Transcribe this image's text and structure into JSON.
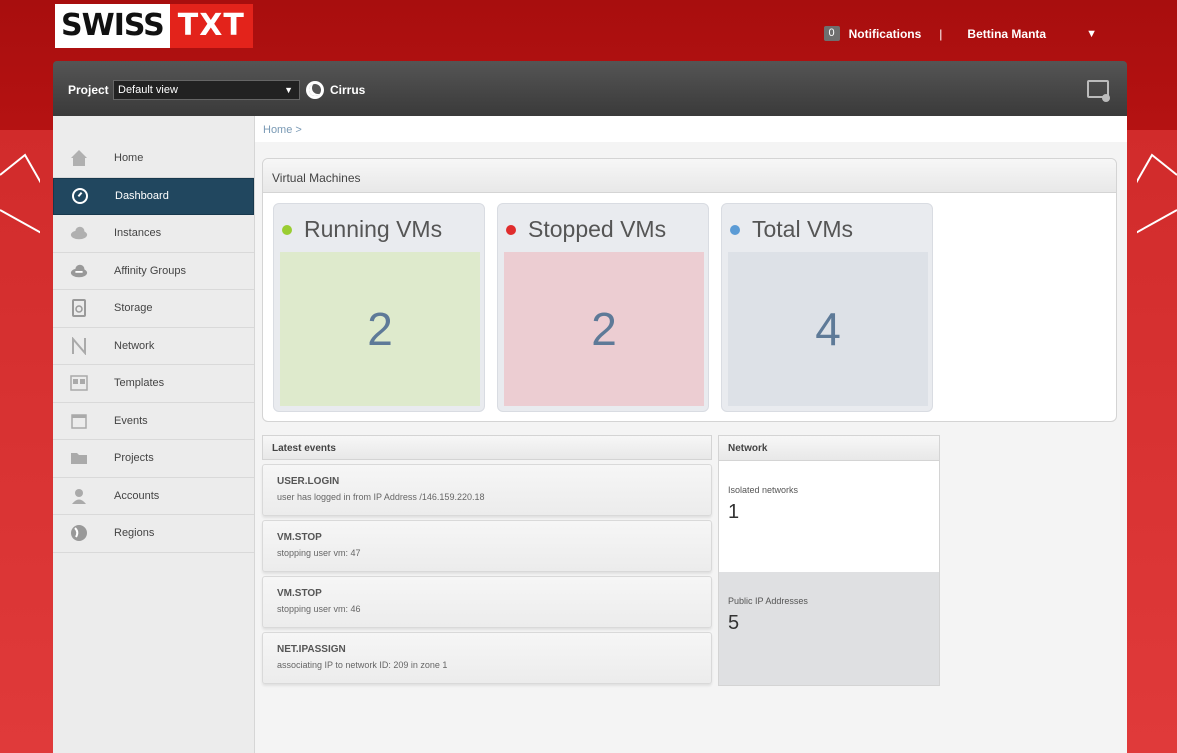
{
  "header": {
    "logo_part1": "SWISS",
    "logo_part2": "TXT",
    "notifications_count": "0",
    "notifications_label": "Notifications",
    "separator": "|",
    "user_name": "Bettina Manta",
    "user_caret": "▼"
  },
  "project_bar": {
    "project_label": "Project",
    "project_select_value": "Default view",
    "zone_name": "Cirrus"
  },
  "sidebar": {
    "items": [
      {
        "label": "Home",
        "icon": "home-icon"
      },
      {
        "label": "Dashboard",
        "icon": "dashboard-icon",
        "active": true
      },
      {
        "label": "Instances",
        "icon": "cloud-icon"
      },
      {
        "label": "Affinity Groups",
        "icon": "affinity-cloud-icon"
      },
      {
        "label": "Storage",
        "icon": "disk-icon"
      },
      {
        "label": "Network",
        "icon": "network-icon"
      },
      {
        "label": "Templates",
        "icon": "templates-icon"
      },
      {
        "label": "Events",
        "icon": "calendar-icon"
      },
      {
        "label": "Projects",
        "icon": "folder-icon"
      },
      {
        "label": "Accounts",
        "icon": "user-icon"
      },
      {
        "label": "Regions",
        "icon": "globe-icon"
      }
    ]
  },
  "breadcrumb": {
    "home": "Home",
    "sep": ">"
  },
  "vm_panel": {
    "title": "Virtual Machines",
    "cards": [
      {
        "label": "Running VMs",
        "value": "2",
        "dot_color": "#9acd32",
        "box_color": "#deeacc"
      },
      {
        "label": "Stopped VMs",
        "value": "2",
        "dot_color": "#e02d2d",
        "box_color": "#eccdd2"
      },
      {
        "label": "Total VMs",
        "value": "4",
        "dot_color": "#5b9bd5",
        "box_color": "#dde1e7"
      }
    ]
  },
  "events": {
    "title": "Latest events",
    "items": [
      {
        "type": "USER.LOGIN",
        "desc": "user has logged in from IP Address /146.159.220.18"
      },
      {
        "type": "VM.STOP",
        "desc": "stopping user vm: 47"
      },
      {
        "type": "VM.STOP",
        "desc": "stopping user vm: 46"
      },
      {
        "type": "NET.IPASSIGN",
        "desc": "associating IP to network ID: 209 in zone 1"
      }
    ]
  },
  "network": {
    "title": "Network",
    "isolated_label": "Isolated networks",
    "isolated_value": "1",
    "public_ip_label": "Public IP Addresses",
    "public_ip_value": "5"
  }
}
